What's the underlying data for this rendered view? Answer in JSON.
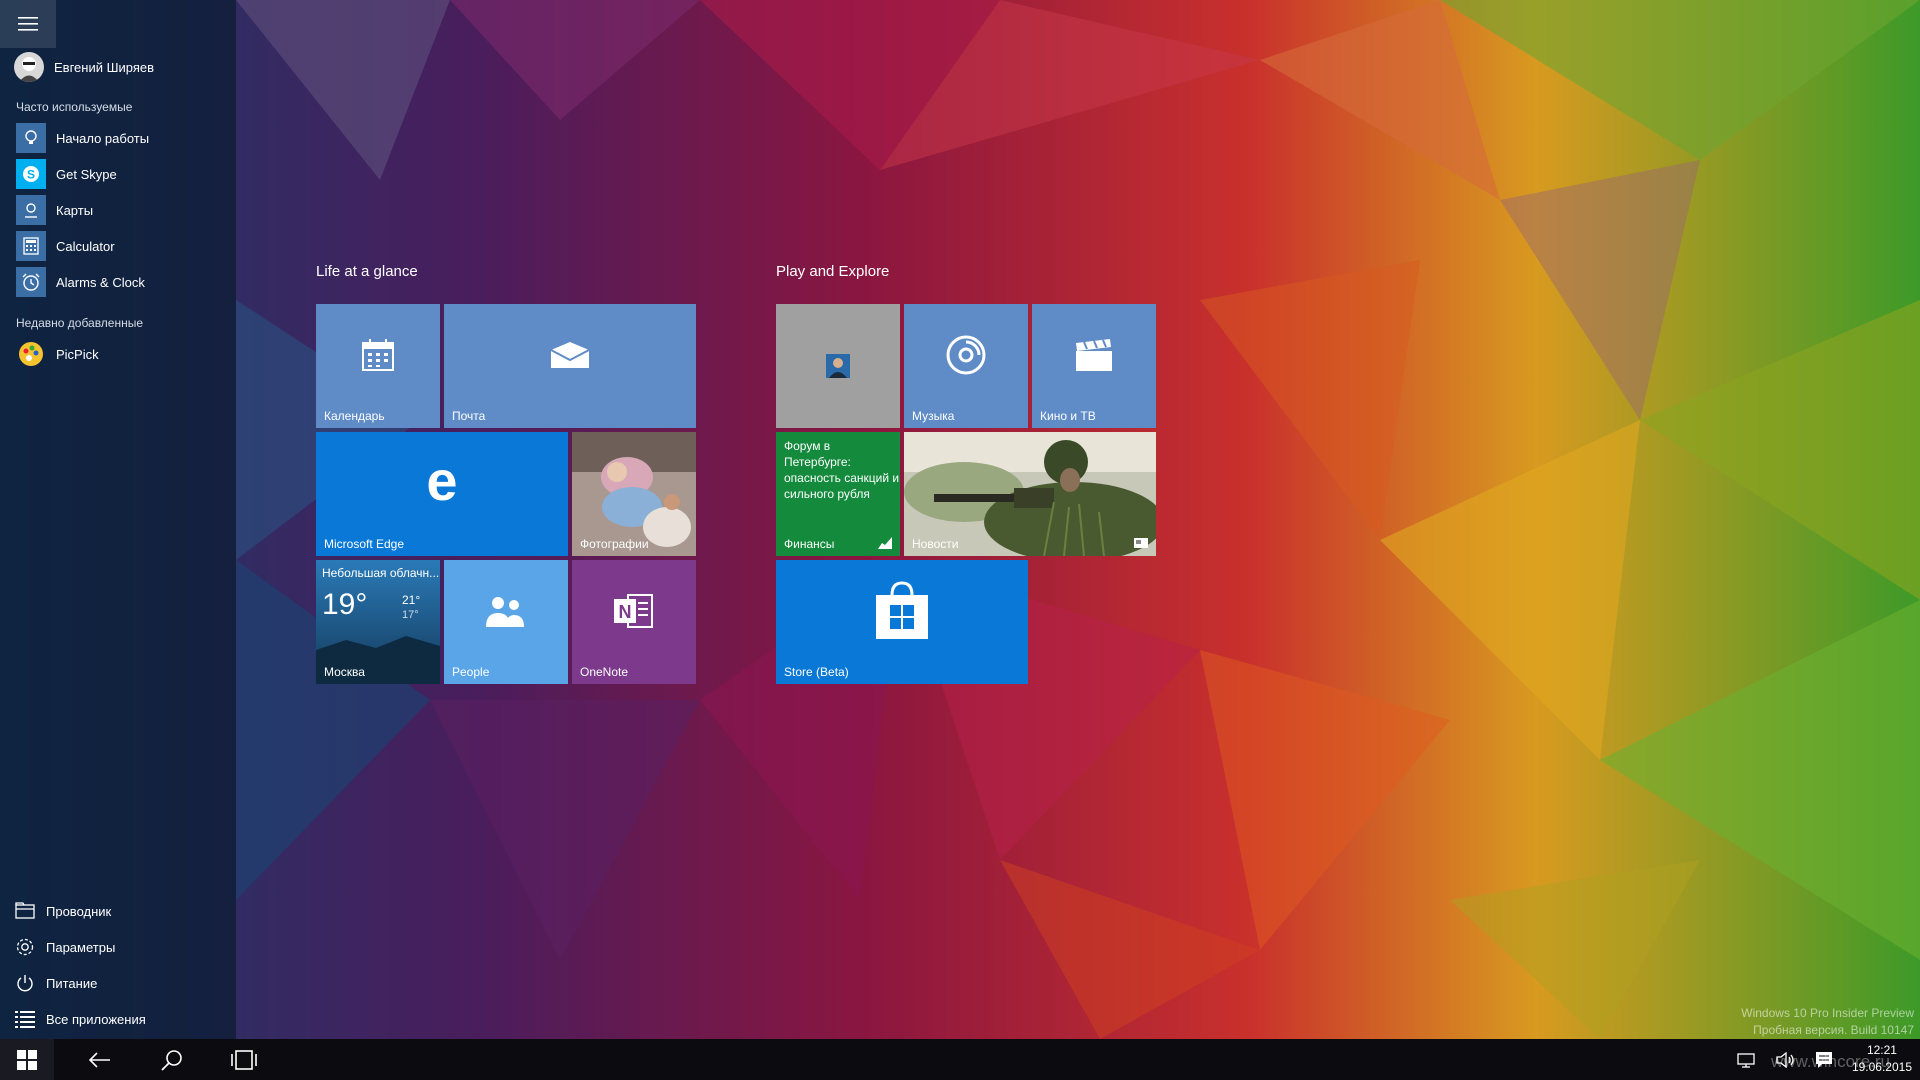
{
  "start_menu": {
    "user_name": "Евгений Ширяев",
    "most_used_heading": "Часто используемые",
    "most_used": [
      {
        "label": "Начало работы",
        "icon": "lightbulb-icon",
        "color": "#3a6ea5"
      },
      {
        "label": "Get Skype",
        "icon": "skype-icon",
        "color": "#00aff0"
      },
      {
        "label": "Карты",
        "icon": "maps-icon",
        "color": "#3a6ea5"
      },
      {
        "label": "Calculator",
        "icon": "calculator-icon",
        "color": "#3a6ea5"
      },
      {
        "label": "Alarms & Clock",
        "icon": "alarm-clock-icon",
        "color": "#3a6ea5"
      }
    ],
    "recent_heading": "Недавно добавленные",
    "recent": [
      {
        "label": "PicPick",
        "icon": "picpick-icon"
      }
    ],
    "system": [
      {
        "label": "Проводник",
        "icon": "file-explorer-icon"
      },
      {
        "label": "Параметры",
        "icon": "gear-icon"
      },
      {
        "label": "Питание",
        "icon": "power-icon"
      },
      {
        "label": "Все приложения",
        "icon": "all-apps-icon"
      }
    ]
  },
  "tiles": {
    "group1_title": "Life at a glance",
    "group2_title": "Play and Explore",
    "calendar": "Календарь",
    "mail": "Почта",
    "edge": "Microsoft Edge",
    "photos": "Фотографии",
    "weather": {
      "condition": "Небольшая облачн...",
      "temp": "19°",
      "high": "21°",
      "low": "17°",
      "city": "Москва"
    },
    "people": "People",
    "onenote": "OneNote",
    "music": "Музыка",
    "movies": "Кино и ТВ",
    "finance": {
      "headline": "Форум в Петербурге: опасность санкций и сильного рубля",
      "label": "Финансы"
    },
    "news": "Новости",
    "store": "Store (Beta)"
  },
  "colors": {
    "tile_blue": "#5f8bc6",
    "tile_edge": "#0a78d7",
    "tile_people": "#5aa5e8",
    "tile_onenote": "#7d3a8c",
    "tile_finance": "#138a3c",
    "tile_store": "#0a78d7",
    "tile_gray": "#a0a0a0"
  },
  "watermark": {
    "line1": "Windows 10 Pro Insider Preview",
    "line2": "Пробная версия. Build 10147",
    "site": "www.wincore.ru"
  },
  "clock": {
    "time": "12:21",
    "date": "19.06.2015"
  }
}
